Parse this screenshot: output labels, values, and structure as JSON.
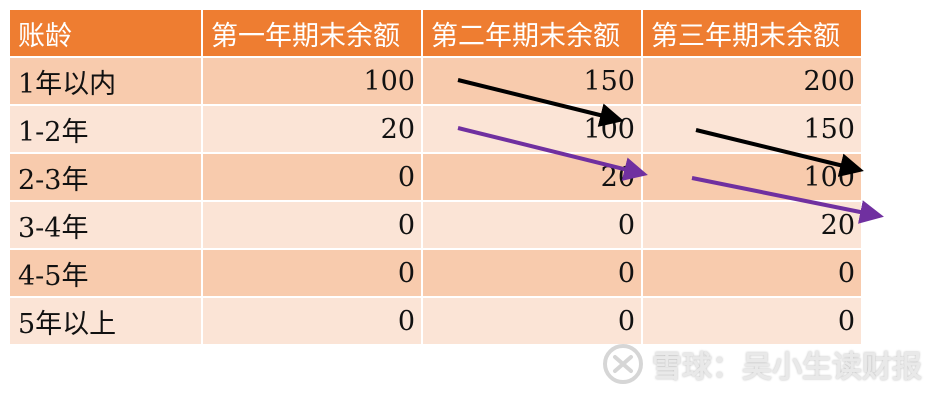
{
  "table": {
    "headers": [
      "账龄",
      "第一年期末余额",
      "第二年期末余额",
      "第三年期末余额"
    ],
    "rows": [
      {
        "label": "1年以内",
        "values": [
          "100",
          "150",
          "200"
        ]
      },
      {
        "label": "1-2年",
        "values": [
          "20",
          "100",
          "150"
        ]
      },
      {
        "label": "2-3年",
        "values": [
          "0",
          "20",
          "100"
        ]
      },
      {
        "label": "3-4年",
        "values": [
          "0",
          "0",
          "20"
        ]
      },
      {
        "label": "4-5年",
        "values": [
          "0",
          "0",
          "0"
        ]
      },
      {
        "label": "5年以上",
        "values": [
          "0",
          "0",
          "0"
        ]
      }
    ]
  },
  "arrows": [
    {
      "name": "arrow-100-shift",
      "color": "#000000"
    },
    {
      "name": "arrow-20-shift",
      "color": "#7030a0"
    }
  ],
  "watermark": {
    "text": "雪球：吴小生读财报",
    "icon": "snowball-logo-icon"
  },
  "colors": {
    "header": "#ee7d31",
    "row_dark": "#f8cbad",
    "row_light": "#fbe4d6"
  }
}
